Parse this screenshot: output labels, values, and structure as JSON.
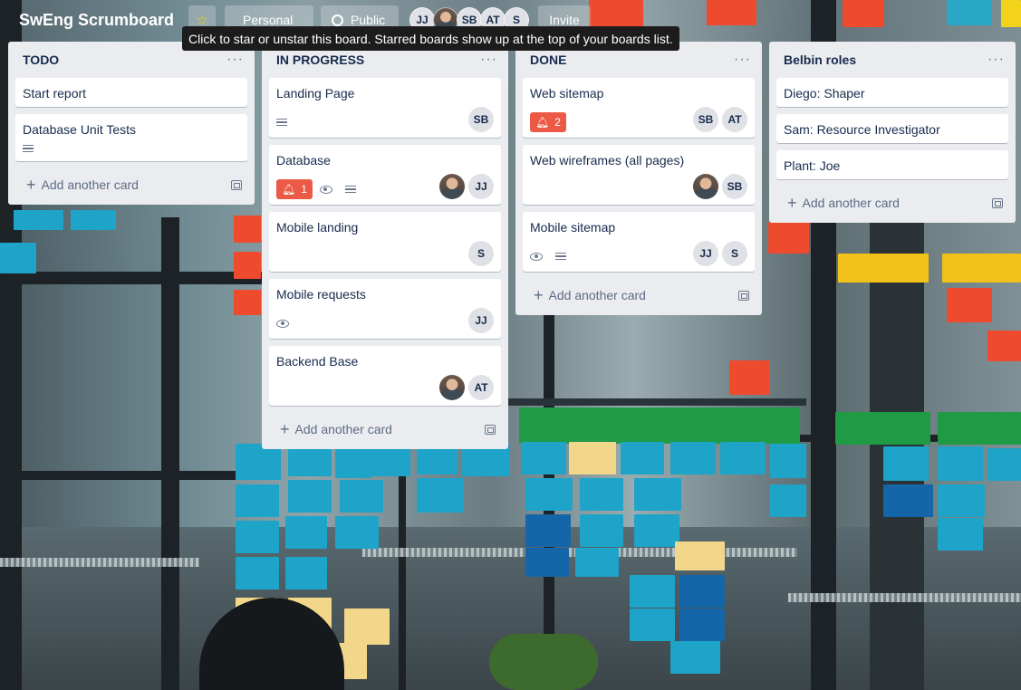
{
  "header": {
    "board_title": "SwEng Scrumboard",
    "personal_label": "Personal",
    "public_label": "Public",
    "invite_label": "Invite",
    "members": [
      "JJ",
      "",
      "SB",
      "AT",
      "S"
    ]
  },
  "tooltip": "Click to star or unstar this board. Starred boards show up at the top of your boards list.",
  "add_card_label": "Add another card",
  "lists": [
    {
      "title": "TODO",
      "cards": [
        {
          "title": "Start report"
        },
        {
          "title": "Database Unit Tests",
          "badges": [
            "description"
          ]
        }
      ]
    },
    {
      "title": "IN PROGRESS",
      "cards": [
        {
          "title": "Landing Page",
          "badges": [
            "description"
          ],
          "members": [
            "SB"
          ]
        },
        {
          "title": "Database",
          "due": "1",
          "badges": [
            "watch",
            "description"
          ],
          "members": [
            "photo",
            "JJ"
          ]
        },
        {
          "title": "Mobile landing",
          "members": [
            "S"
          ]
        },
        {
          "title": "Mobile requests",
          "badges": [
            "watch"
          ],
          "members": [
            "JJ"
          ]
        },
        {
          "title": "Backend Base",
          "members": [
            "photo",
            "AT"
          ]
        }
      ]
    },
    {
      "title": "DONE",
      "cards": [
        {
          "title": "Web sitemap",
          "due": "2",
          "members": [
            "SB",
            "AT"
          ]
        },
        {
          "title": "Web wireframes (all pages)",
          "members": [
            "photo",
            "SB"
          ]
        },
        {
          "title": "Mobile sitemap",
          "badges": [
            "watch",
            "description"
          ],
          "members": [
            "JJ",
            "S"
          ]
        }
      ]
    },
    {
      "title": "Belbin roles",
      "cards": [
        {
          "title": "Diego: Shaper"
        },
        {
          "title": "Sam: Resource Investigator"
        },
        {
          "title": "Plant: Joe"
        }
      ]
    }
  ]
}
